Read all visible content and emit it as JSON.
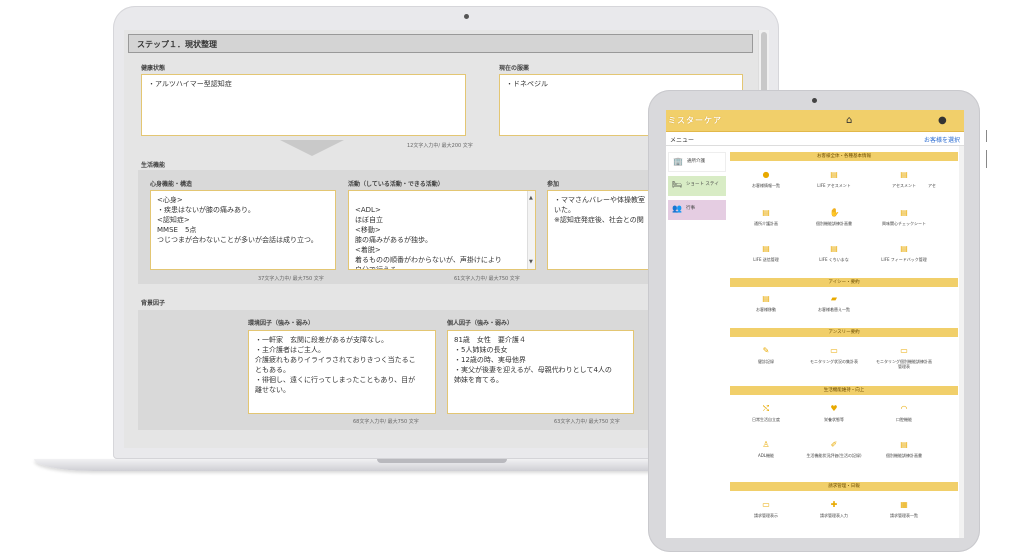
{
  "laptop": {
    "step_title": "ステップ１．現状整理",
    "health_label": "健康状態",
    "health_text": "・アルツハイマー型認知症",
    "health_count": "12文字入力中/ 最大200 文字",
    "drug_label": "現在の服薬",
    "drug_text": "・ドネペジル",
    "life_label": "生活機能",
    "body_label": "心身機能・構造",
    "body_text": "<心身>\n・疾患はないが膝の痛みあり。\n<認知症>\nMMSE　5点\nつじつまが合わないことが多いが会話は成り立つ。",
    "body_count": "37文字入力中/ 最大750 文字",
    "activity_label": "活動（している活動・できる活動）",
    "activity_text": "<ADL>\nほぼ自立\n<移動>\n膝の痛みがあるが独歩。\n<着脱>\n着るものの順番がわからないが、声掛けにより\n自分で行える。",
    "activity_count": "61文字入力中/ 最大750 文字",
    "participation_label": "参加",
    "participation_text": "・ママさんバレーや体操教室\nいた。\n※認知症発症後、社会との関",
    "bg_label": "背景因子",
    "env_label": "環境因子（強み・弱み）",
    "env_text": "・一軒家　玄関に段差があるが支障なし。\n・主介護者はご主人。\n介護疲れもありイライラされておりきつく当たるこ\nともある。\n・徘徊し、遠くに行ってしまったこともあり、目が\n離せない。",
    "env_count": "68文字入力中/ 最大750 文字",
    "personal_label": "個人因子（強み・弱み）",
    "personal_text": "81歳　女性　要介護４\n・5人姉妹の長女\n・12歳の時、実母他界\n・実父が後妻を迎えるが、母親代わりとして4人の\n姉妹を育てる。",
    "personal_count": "63文字入力中/ 最大750 文字"
  },
  "tablet": {
    "logo": "ミスターケア",
    "menu_label": "メニュー",
    "select_user": "お客様を選択",
    "nav": [
      {
        "label": "通所介護",
        "icon": "🏢"
      },
      {
        "label": "ショート\nステイ",
        "icon": "🛏"
      },
      {
        "label": "行事",
        "icon": "👥"
      }
    ],
    "bands": [
      "お客様全体・各種基本情報",
      "アイシー・要約",
      "アンスリー要約",
      "生活機能維持・向上",
      "請求管理・日報"
    ],
    "tiles_row1": [
      "お客様情報一覧",
      "LIFE アセスメント",
      "アセスメント",
      "アセ"
    ],
    "tiles_row2": [
      "通所介護計画",
      "個別機能訓練計画書",
      "興味関心チェックシート"
    ],
    "tiles_row3": [
      "LIFE 送信管理",
      "LIFE くちいまな",
      "LIFE フィードバック管理"
    ],
    "tiles_row4": [
      "お客様移動",
      "お客様着替え一覧"
    ],
    "tiles_row5": [
      "健診記録",
      "モニタリング状況の集計表",
      "モニタリング個別機能訓練計画管理表"
    ],
    "tiles_row6": [
      "日常生活自立度",
      "栄養状態等",
      "口腔機能"
    ],
    "tiles_row7": [
      "ADL機能",
      "生活機能状況評価(生活の記録)",
      "個別機能訓練計画書"
    ],
    "tiles_row8": [
      "請求管理表示",
      "請求管理表入力",
      "請求管理表一覧"
    ]
  },
  "colors": {
    "accent": "#f1cf6a",
    "box_border": "#e3c673"
  }
}
